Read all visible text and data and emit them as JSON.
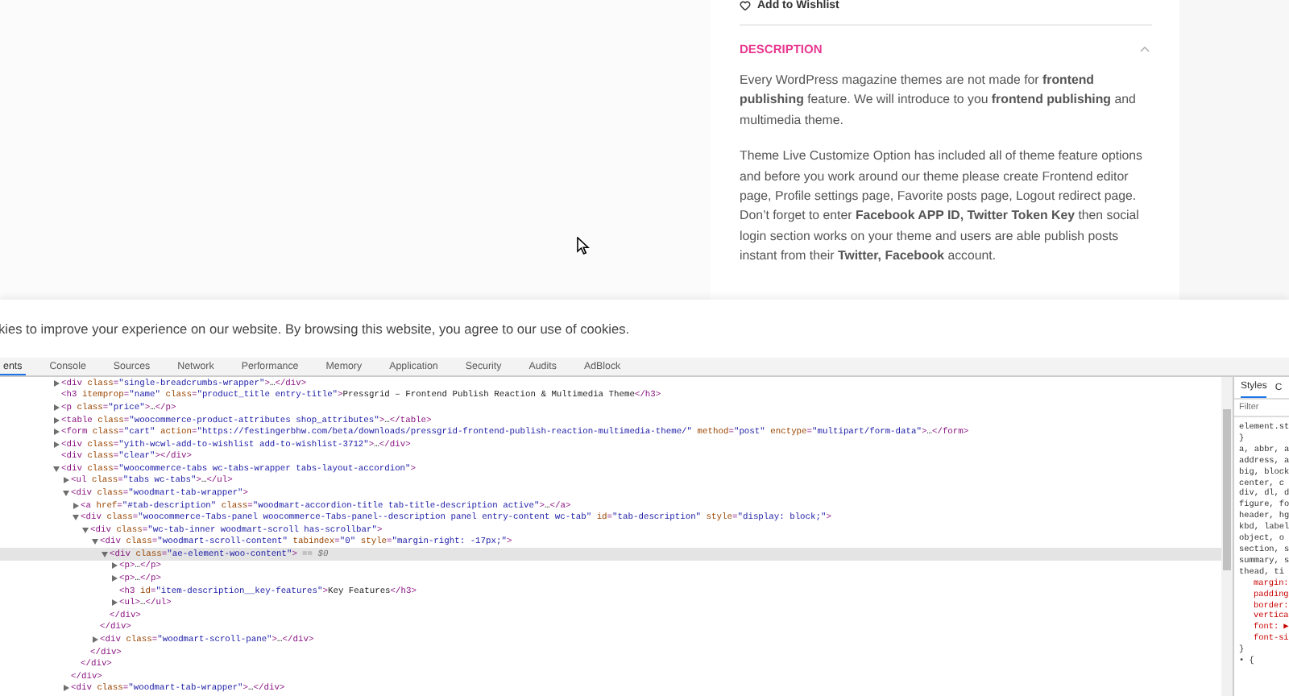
{
  "product_card": {
    "wishlist_link": "Add to Wishlist",
    "section_title": "DESCRIPTION",
    "expanded": true,
    "paragraphs": [
      "Every WordPress magazine themes are not made for **frontend publishing** feature. We will introduce to you **frontend publishing** and multimedia theme.",
      "Theme Live Customize Option has included all of theme feature options and before you work around our theme please create Frontend editor page, Profile settings page, Favorite posts page, Logout redirect page. Don’t forget to enter **Facebook APP ID, Twitter Token Key** then social login section works on your theme and users are able publish posts instant from their **Twitter, Facebook** account."
    ]
  },
  "cookie_notice": "kies to improve your experience on our website. By browsing this website, you agree to our use of cookies.",
  "devtools": {
    "tabs": [
      {
        "label": "ents",
        "selected": true
      },
      {
        "label": "Console",
        "selected": false
      },
      {
        "label": "Sources",
        "selected": false
      },
      {
        "label": "Network",
        "selected": false
      },
      {
        "label": "Performance",
        "selected": false
      },
      {
        "label": "Memory",
        "selected": false
      },
      {
        "label": "Application",
        "selected": false
      },
      {
        "label": "Security",
        "selected": false
      },
      {
        "label": "Audits",
        "selected": false
      },
      {
        "label": "AdBlock",
        "selected": false
      }
    ],
    "dom_tree": [
      {
        "tag": "<div class=\"single-breadcrumbs-wrapper\">…</div>",
        "expanded": false,
        "selected": false
      },
      {
        "tag": "<h3 itemprop=\"name\" class=\"product_title entry-title\">Pressgrid – Frontend Publish Reaction & Multimedia Theme</h3>",
        "selected": false
      },
      {
        "tag": "<p class=\"price\">…</p>",
        "expanded": false,
        "selected": false
      },
      {
        "tag": "<table class=\"woocommerce-product-attributes shop_attributes\">…</table>",
        "expanded": false,
        "selected": false
      },
      {
        "tag": "<form class=\"cart\" action=\"https://festingerbhw.com/beta/downloads/pressgrid-frontend-publish-reaction-multimedia-theme/\" method=\"post\" enctype=\"multipart/form-data\">…</form>",
        "expanded": false,
        "selected": false
      },
      {
        "tag": "<div class=\"yith-wcwl-add-to-wishlist add-to-wishlist-3712\">…</div>",
        "expanded": false,
        "selected": false
      },
      {
        "tag": "<div class=\"clear\"></div>",
        "selected": false
      },
      {
        "tag": "<div class=\"woocommerce-tabs wc-tabs-wrapper tabs-layout-accordion\">",
        "expanded": true,
        "selected": false,
        "children": [
          {
            "tag": "<ul class=\"tabs wc-tabs\">…</ul>",
            "expanded": false,
            "selected": false
          },
          {
            "tag": "<div class=\"woodmart-tab-wrapper\">",
            "expanded": true,
            "selected": false,
            "closing": "</div>",
            "children": [
              {
                "tag": "<a href=\"#tab-description\" class=\"woodmart-accordion-title tab-title-description active\">…</a>",
                "expanded": false,
                "selected": false
              },
              {
                "tag": "<div class=\"woocommerce-Tabs-panel woocommerce-Tabs-panel--description panel entry-content wc-tab\" id=\"tab-description\" style=\"display: block;\">",
                "expanded": true,
                "selected": false,
                "closing": "</div>",
                "children": [
                  {
                    "tag": "<div class=\"wc-tab-inner woodmart-scroll has-scrollbar\">",
                    "expanded": true,
                    "selected": false,
                    "closing": "</div>",
                    "children": [
                      {
                        "tag": "<div class=\"woodmart-scroll-content\" tabindex=\"0\" style=\"margin-right: -17px;\">",
                        "expanded": true,
                        "selected": false,
                        "closing": "</div>",
                        "children": [
                          {
                            "tag": "<div class=\"ae-element-woo-content\">",
                            "console_ref": "== $0",
                            "expanded": true,
                            "selected": true,
                            "closing": "</div>",
                            "children": [
                              {
                                "tag": "<p>…</p>",
                                "expanded": false,
                                "selected": false
                              },
                              {
                                "tag": "<p>…</p>",
                                "expanded": false,
                                "selected": false
                              },
                              {
                                "tag": "<h3 id=\"item-description__key-features\">Key Features</h3>",
                                "selected": false
                              },
                              {
                                "tag": "<ul>…</ul>",
                                "expanded": false,
                                "selected": false
                              }
                            ]
                          }
                        ]
                      },
                      {
                        "tag": "<div class=\"woodmart-scroll-pane\">…</div>",
                        "expanded": false,
                        "selected": false
                      }
                    ]
                  }
                ]
              }
            ]
          },
          {
            "tag": "<div class=\"woodmart-tab-wrapper\">…</div>",
            "expanded": false,
            "selected": false
          }
        ]
      }
    ],
    "styles_pane": {
      "tabs": [
        {
          "label": "Styles",
          "selected": true
        },
        {
          "label": "C",
          "selected": false
        }
      ],
      "filter_placeholder": "Filter",
      "lines": [
        {
          "text": "element.st",
          "kind": "selector"
        },
        {
          "text": "}",
          "kind": "selector"
        },
        {
          "text": "a, abbr, a",
          "kind": "selector"
        },
        {
          "text": "address, a",
          "kind": "selector"
        },
        {
          "text": "big, block",
          "kind": "selector"
        },
        {
          "text": "center, c",
          "kind": "selector"
        },
        {
          "text": "div, dl, d",
          "kind": "selector"
        },
        {
          "text": "figure, fo",
          "kind": "selector"
        },
        {
          "text": "header, hg",
          "kind": "selector"
        },
        {
          "text": "kbd, label",
          "kind": "selector"
        },
        {
          "text": "object, o",
          "kind": "selector"
        },
        {
          "text": "section, s",
          "kind": "selector"
        },
        {
          "text": "summary, s",
          "kind": "selector"
        },
        {
          "text": "thead, ti",
          "kind": "selector"
        },
        {
          "text": "margin:",
          "kind": "property"
        },
        {
          "text": "padding",
          "kind": "property"
        },
        {
          "text": "border:",
          "kind": "property"
        },
        {
          "text": "vertica",
          "kind": "property"
        },
        {
          "text": "font: ▶",
          "kind": "property"
        },
        {
          "text": "font-si",
          "kind": "property"
        },
        {
          "text": "}",
          "kind": "selector"
        },
        {
          "text": "• {",
          "kind": "selector"
        }
      ]
    }
  }
}
